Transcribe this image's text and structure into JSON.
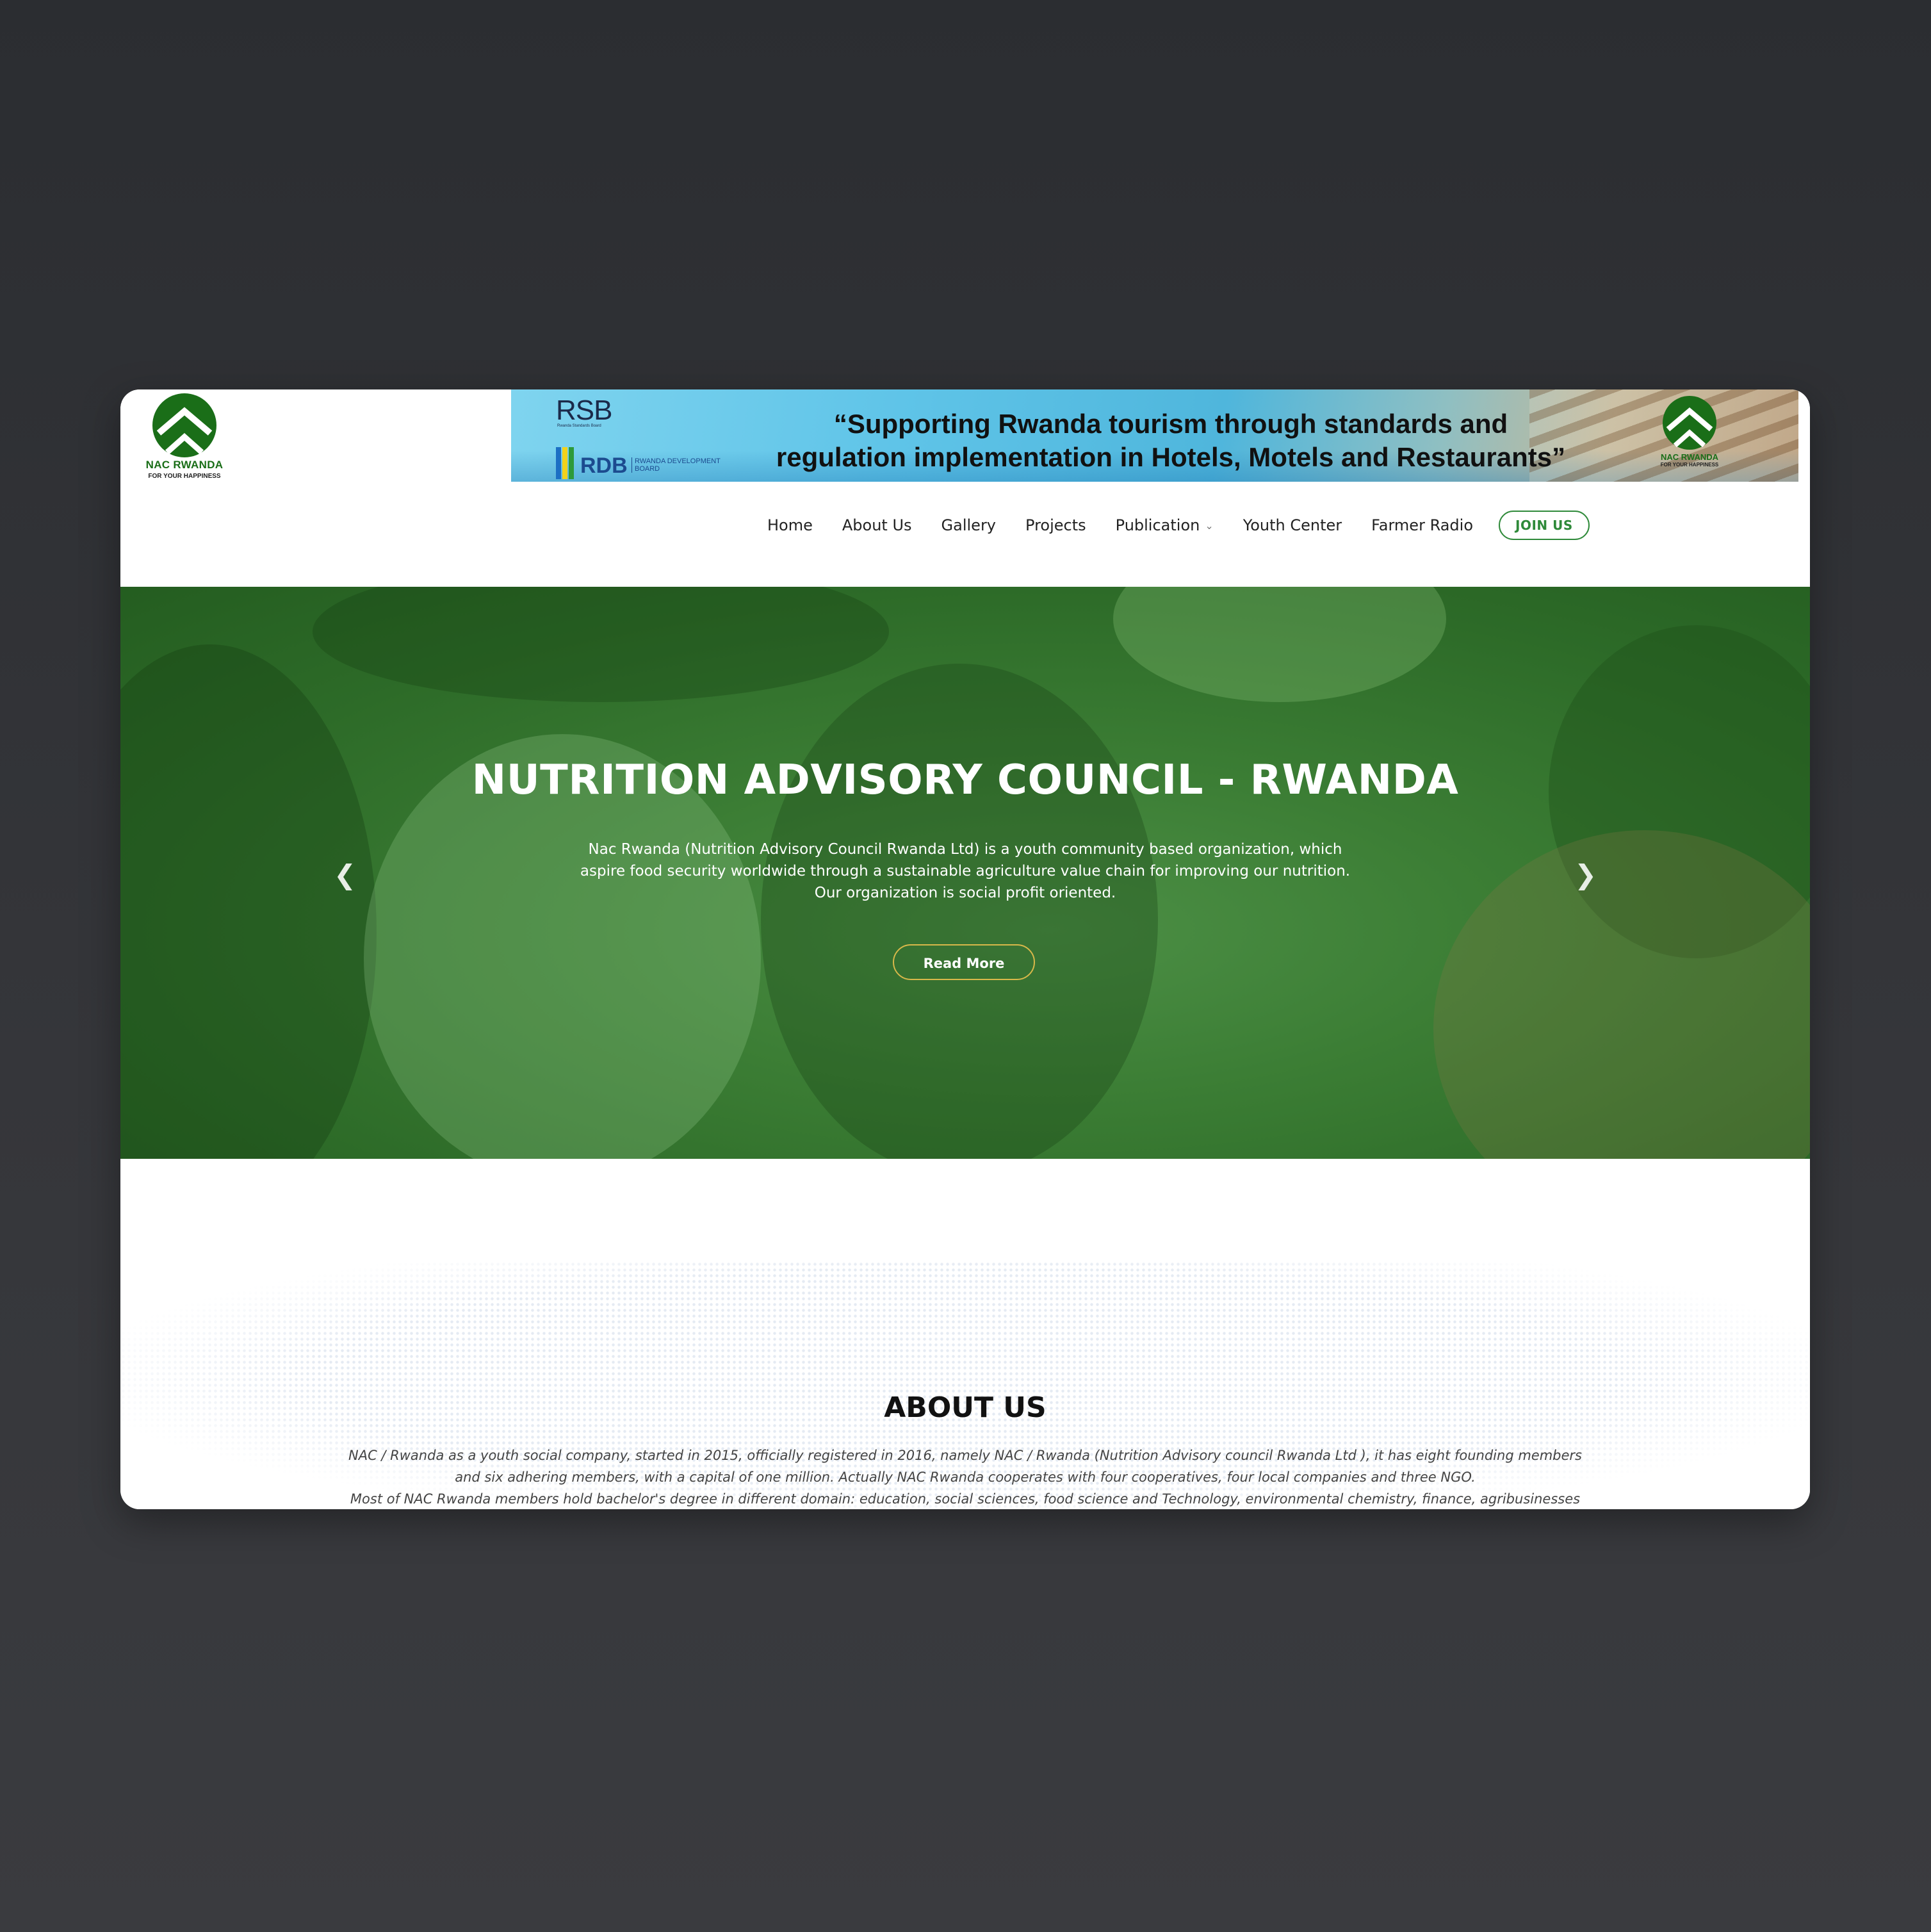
{
  "header": {
    "logo": {
      "name": "NAC RWANDA",
      "tagline": "FOR YOUR HAPPINESS"
    },
    "banner": {
      "rsb_label": "RSB",
      "rsb_sub": "Rwanda Standards Board",
      "rdb_label": "RDB",
      "rdb_sub": "RWANDA DEVELOPMENT BOARD",
      "quote_line1": "“Supporting Rwanda tourism through standards and",
      "quote_line2": "regulation implementation in Hotels, Motels and Restaurants”",
      "logo_name": "NAC RWANDA",
      "logo_tagline": "FOR YOUR HAPPINESS"
    }
  },
  "nav": {
    "items": [
      "Home",
      "About Us",
      "Gallery",
      "Projects",
      "Publication",
      "Youth Center",
      "Farmer Radio"
    ],
    "join_label": "JOIN US"
  },
  "hero": {
    "title": "NUTRITION ADVISORY COUNCIL - RWANDA",
    "line1": "Nac Rwanda (Nutrition Advisory Council Rwanda Ltd) is a youth community based organization, which",
    "line2": "aspire food security worldwide through a sustainable agriculture value chain for improving our nutrition.",
    "line3": "Our organization is social profit oriented.",
    "button": "Read More"
  },
  "about": {
    "title": "ABOUT US",
    "line1": "NAC / Rwanda as a youth social company, started in 2015, officially registered in 2016, namely NAC / Rwanda (Nutrition Advisory council Rwanda Ltd ), it has eight founding members",
    "line2": "and six adhering members, with a capital of one million. Actually NAC Rwanda cooperates with four cooperatives, four local companies and three NGO.",
    "line3": "Most of NAC Rwanda members hold bachelor's degree in different domain: education, social sciences, food science and Technology, environmental chemistry, finance, agribusinesses"
  },
  "colors": {
    "brand_green": "#1a6e18",
    "join_border": "#2f8a3a",
    "hero_overlay": "#3b7d34",
    "read_more_border": "#d8b84a"
  }
}
